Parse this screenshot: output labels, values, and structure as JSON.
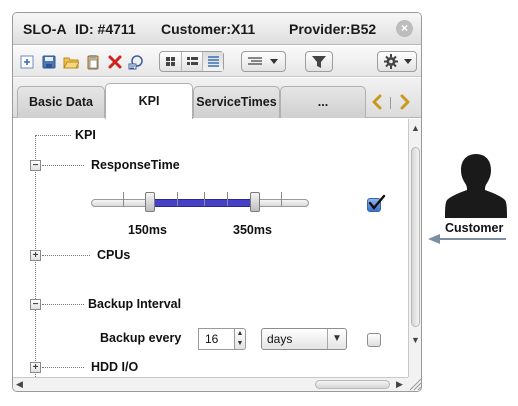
{
  "window": {
    "title_slo": "SLO-A",
    "title_id": "ID: #4711",
    "title_customer": "Customer:X11",
    "title_provider": "Provider:B52"
  },
  "toolbar": {
    "icons": [
      "new-icon",
      "save-icon",
      "open-icon",
      "paste-icon",
      "delete-icon",
      "properties-icon",
      "view-large-icon",
      "view-small-icon",
      "view-list-icon",
      "align-icon",
      "filter-icon",
      "settings-icon"
    ]
  },
  "tabs": [
    {
      "label": "Basic Data",
      "active": false
    },
    {
      "label": "KPI",
      "active": true
    },
    {
      "label": "ServiceTimes",
      "active": false
    },
    {
      "label": "...",
      "active": false
    }
  ],
  "tree": {
    "root": "KPI",
    "response_time": {
      "label": "ResponseTime",
      "min_label": "150ms",
      "max_label": "350ms",
      "range_start_fraction": 0.27,
      "range_end_fraction": 0.75,
      "enabled": true
    },
    "cpus": {
      "label": "CPUs"
    },
    "backup_interval": {
      "label": "Backup Interval",
      "row_label": "Backup every",
      "value": "16",
      "unit": "days",
      "enabled": false
    },
    "hdd_io": {
      "label": "HDD I/O"
    }
  },
  "customer": {
    "label": "Customer"
  },
  "colors": {
    "slider_range": "#4540c4",
    "checkbox_checked": "#3b72c9",
    "arrow": "#7a8ea6"
  }
}
